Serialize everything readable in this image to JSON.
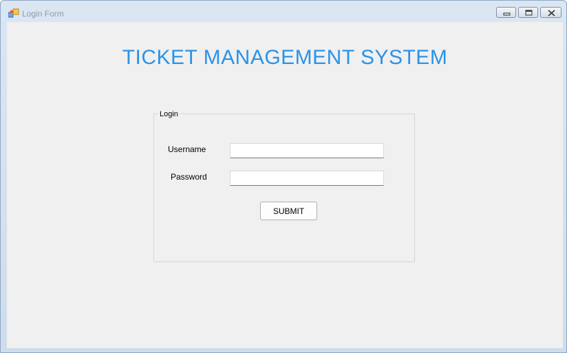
{
  "window": {
    "title": "Login Form",
    "icon": "form-window-icon",
    "caption_buttons": [
      "minimize-icon",
      "restore-icon",
      "close-icon"
    ]
  },
  "main": {
    "heading": "TICKET MANAGEMENT SYSTEM",
    "heading_color": "#2a93e8"
  },
  "login_group": {
    "legend": "Login",
    "username_label": "Username",
    "username_value": "",
    "password_label": "Password",
    "password_value": "",
    "submit_label": "SUBMIT"
  }
}
